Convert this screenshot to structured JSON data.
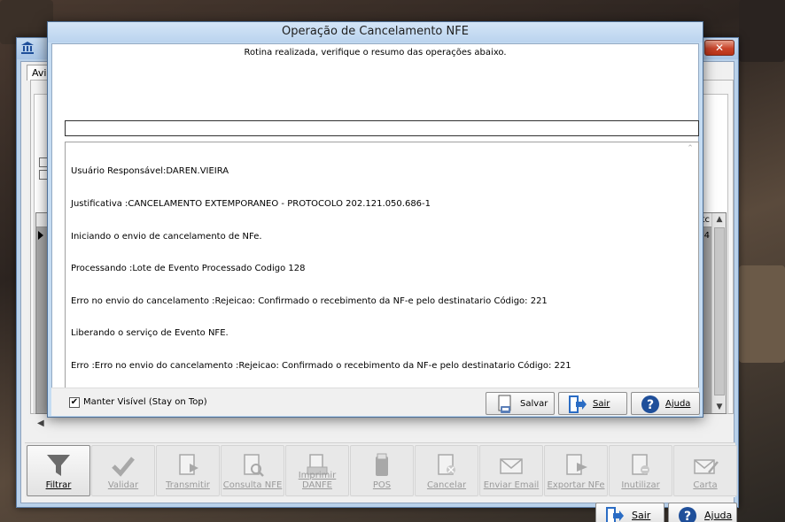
{
  "back_window": {
    "tab_label": "Aviso",
    "grid_header_fragment": "tc",
    "grid_cell_fragment": "4"
  },
  "toolbar": {
    "buttons": [
      {
        "label": "Filtrar",
        "icon": "funnel-icon"
      },
      {
        "label": "Validar",
        "icon": "checkmark-icon"
      },
      {
        "label": "Transmitir",
        "icon": "document-arrow-icon"
      },
      {
        "label": "Consulta NFE",
        "icon": "document-search-icon"
      },
      {
        "label": "Imprimir DANFE",
        "icon": "document-print-icon"
      },
      {
        "label": "POS",
        "icon": "pos-icon"
      },
      {
        "label": "Cancelar",
        "icon": "document-cancel-icon"
      },
      {
        "label": "Enviar Email",
        "icon": "envelope-icon"
      },
      {
        "label": "Exportar NFe",
        "icon": "document-export-icon"
      },
      {
        "label": "Inutilizar",
        "icon": "document-disable-icon"
      },
      {
        "label": "Carta",
        "icon": "envelope-pen-icon"
      }
    ]
  },
  "bottom_buttons": {
    "exit_label": "Sair",
    "help_label": "Ajuda"
  },
  "dialog": {
    "title": "Operação de Cancelamento  NFE",
    "message": "Rotina realizada, verifique o resumo das operações abaixo.",
    "progress_fraction": 0,
    "log": [
      "Usuário Responsável:DAREN.VIEIRA",
      "Justificativa :CANCELAMENTO EXTEMPORANEO - PROTOCOLO 202.121.050.686-1",
      "Iniciando o envio de cancelamento de NFe.",
      "Processando :Lote de Evento Processado Codigo 128",
      "Erro no envio do cancelamento :Rejeicao: Confirmado o recebimento da NF-e pelo destinatario Código: 221",
      "Liberando o serviço de Evento NFE.",
      "Erro :Erro no envio do cancelamento :Rejeicao: Confirmado o recebimento da NF-e pelo destinatario Código: 221"
    ],
    "stay_on_top_label": "Manter Visível (Stay on Top)",
    "stay_on_top_checked": true,
    "save_label": "Salvar",
    "exit_label": "Sair",
    "help_label": "Ajuda"
  },
  "colors": {
    "titlebar": "#c5dcf2",
    "close_button": "#c9442a",
    "help_icon": "#1f4f9a",
    "exit_icon": "#2a6cc4"
  }
}
